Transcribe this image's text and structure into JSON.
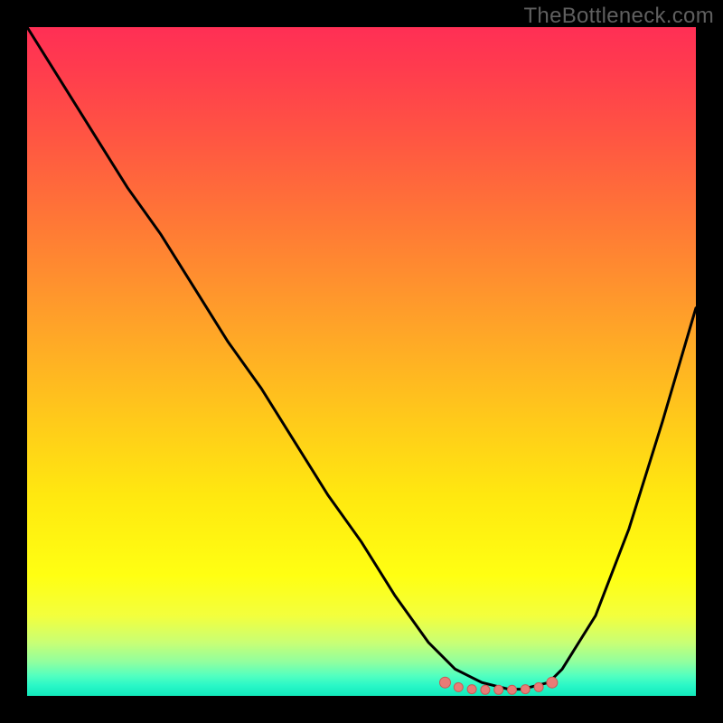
{
  "watermark": "TheBottleneck.com",
  "colors": {
    "frame": "#000000",
    "curve": "#000000",
    "marker_fill": "#e97b76",
    "marker_stroke": "#c85a56"
  },
  "chart_data": {
    "type": "line",
    "title": "",
    "xlabel": "",
    "ylabel": "",
    "xlim": [
      0,
      100
    ],
    "ylim": [
      0,
      100
    ],
    "series": [
      {
        "name": "curve",
        "x": [
          0,
          5,
          10,
          15,
          20,
          25,
          30,
          35,
          40,
          45,
          50,
          55,
          60,
          62,
          64,
          66,
          68,
          70,
          72,
          74,
          76,
          78,
          80,
          85,
          90,
          95,
          100
        ],
        "y": [
          100,
          92,
          84,
          76,
          69,
          61,
          53,
          46,
          38,
          30,
          23,
          15,
          8,
          6,
          4,
          3,
          2,
          1.5,
          1,
          1,
          1.5,
          2,
          4,
          12,
          25,
          41,
          58
        ]
      }
    ],
    "markers": [
      {
        "x": 62.5,
        "y": 2.0,
        "r": 6
      },
      {
        "x": 64.5,
        "y": 1.3,
        "r": 5
      },
      {
        "x": 66.5,
        "y": 1.0,
        "r": 5
      },
      {
        "x": 68.5,
        "y": 0.9,
        "r": 5
      },
      {
        "x": 70.5,
        "y": 0.9,
        "r": 5
      },
      {
        "x": 72.5,
        "y": 0.9,
        "r": 5
      },
      {
        "x": 74.5,
        "y": 1.0,
        "r": 5
      },
      {
        "x": 76.5,
        "y": 1.3,
        "r": 5
      },
      {
        "x": 78.5,
        "y": 2.0,
        "r": 6
      }
    ]
  }
}
